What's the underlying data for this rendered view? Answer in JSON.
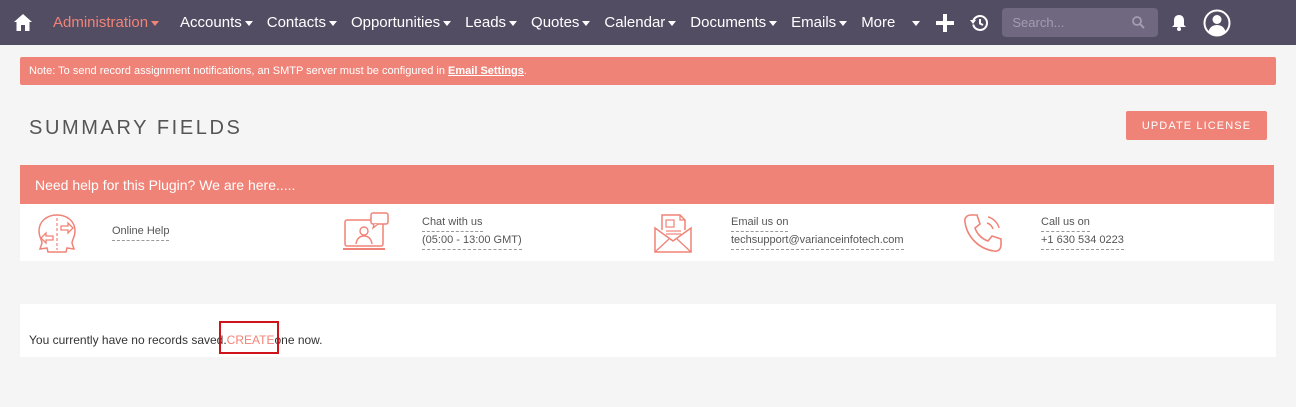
{
  "nav": {
    "active": "Administration",
    "items": [
      "Accounts",
      "Contacts",
      "Opportunities",
      "Leads",
      "Quotes",
      "Calendar",
      "Documents",
      "Emails"
    ],
    "more": "More",
    "search_placeholder": "Search..."
  },
  "alert": {
    "text": "Note: To send record assignment notifications, an SMTP server must be configured in ",
    "link": "Email Settings",
    "suffix": "."
  },
  "page": {
    "title": "SUMMARY FIELDS",
    "update_button": "UPDATE LICENSE"
  },
  "help": {
    "header": "Need help for this Plugin? We are here.....",
    "online_help": "Online Help",
    "chat_title": "Chat with us",
    "chat_hours": "(05:00 - 13:00 GMT)",
    "email_title": "Email us on",
    "email_address": "techsupport@varianceinfotech.com",
    "call_title": "Call us on",
    "call_number": "+1 630 534 0223"
  },
  "records": {
    "prefix": "You currently have no records saved.",
    "create": "CREATE",
    "suffix": "one now."
  },
  "colors": {
    "nav_bg": "#534d64",
    "accent": "#f08377",
    "highlight_box": "#d0121b"
  }
}
